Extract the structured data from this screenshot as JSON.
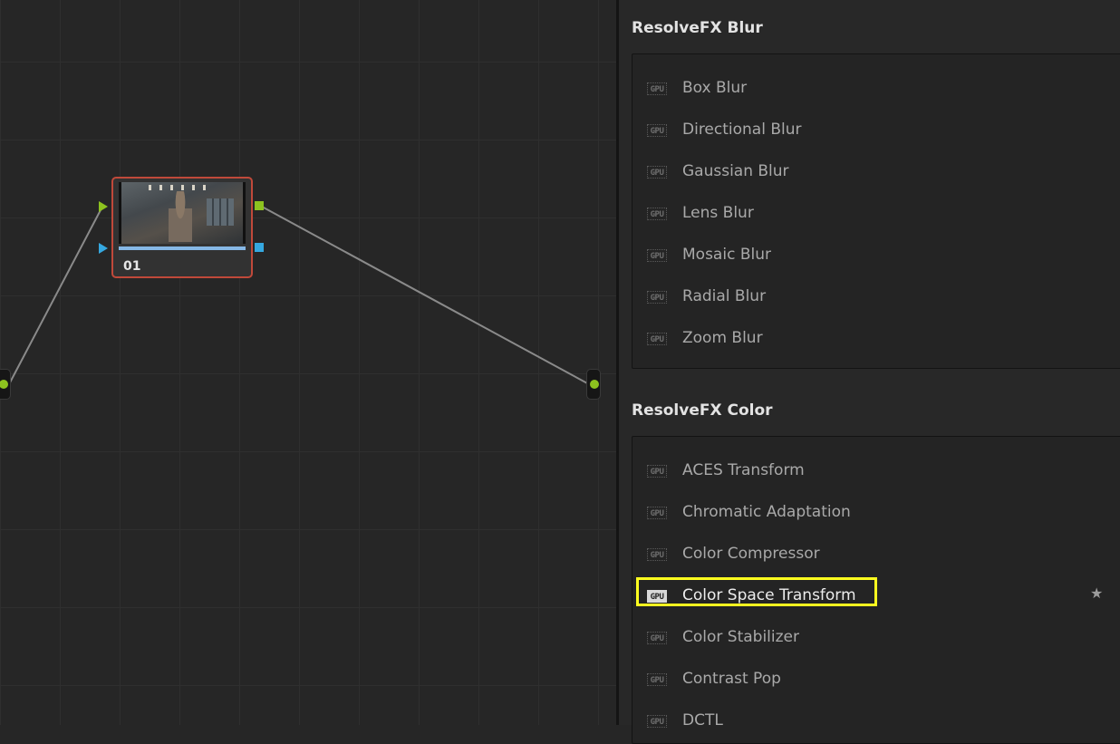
{
  "node_editor": {
    "node": {
      "label": "01"
    },
    "colors": {
      "rgb_port": "#8dc21f",
      "key_port": "#35a8e0",
      "node_border": "#c0493a"
    }
  },
  "library": {
    "categories": [
      {
        "title": "ResolveFX Blur",
        "items": [
          {
            "badge": "GPU",
            "label": "Box Blur"
          },
          {
            "badge": "GPU",
            "label": "Directional Blur"
          },
          {
            "badge": "GPU",
            "label": "Gaussian Blur"
          },
          {
            "badge": "GPU",
            "label": "Lens Blur"
          },
          {
            "badge": "GPU",
            "label": "Mosaic Blur"
          },
          {
            "badge": "GPU",
            "label": "Radial Blur"
          },
          {
            "badge": "GPU",
            "label": "Zoom Blur"
          }
        ]
      },
      {
        "title": "ResolveFX Color",
        "items": [
          {
            "badge": "GPU",
            "label": "ACES Transform"
          },
          {
            "badge": "GPU",
            "label": "Chromatic Adaptation"
          },
          {
            "badge": "GPU",
            "label": "Color Compressor"
          },
          {
            "badge": "GPU",
            "label": "Color Space Transform",
            "selected": true,
            "favorite_icon": "star-icon"
          },
          {
            "badge": "GPU",
            "label": "Color Stabilizer"
          },
          {
            "badge": "GPU",
            "label": "Contrast Pop"
          },
          {
            "badge": "GPU",
            "label": "DCTL"
          }
        ]
      }
    ],
    "highlight_color": "#ffff1f"
  }
}
